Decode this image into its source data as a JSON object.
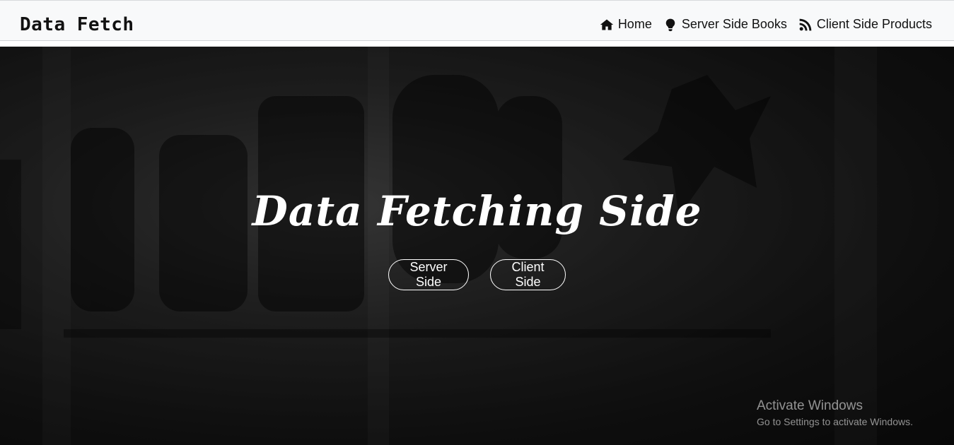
{
  "navbar": {
    "brand": "Data Fetch",
    "links": [
      {
        "label": "Home",
        "icon": "home-icon"
      },
      {
        "label": "Server Side Books",
        "icon": "lightbulb-icon"
      },
      {
        "label": "Client Side Products",
        "icon": "rss-icon"
      }
    ]
  },
  "hero": {
    "title": "Data Fetching Side",
    "buttons": [
      {
        "label": "Server Side"
      },
      {
        "label": "Client Side"
      }
    ]
  },
  "watermark": {
    "title": "Activate Windows",
    "subtitle": "Go to Settings to activate Windows."
  },
  "colors": {
    "navbar_bg": "#f8f9fa",
    "hero_text": "#ffffff",
    "button_border": "#ffffff"
  }
}
